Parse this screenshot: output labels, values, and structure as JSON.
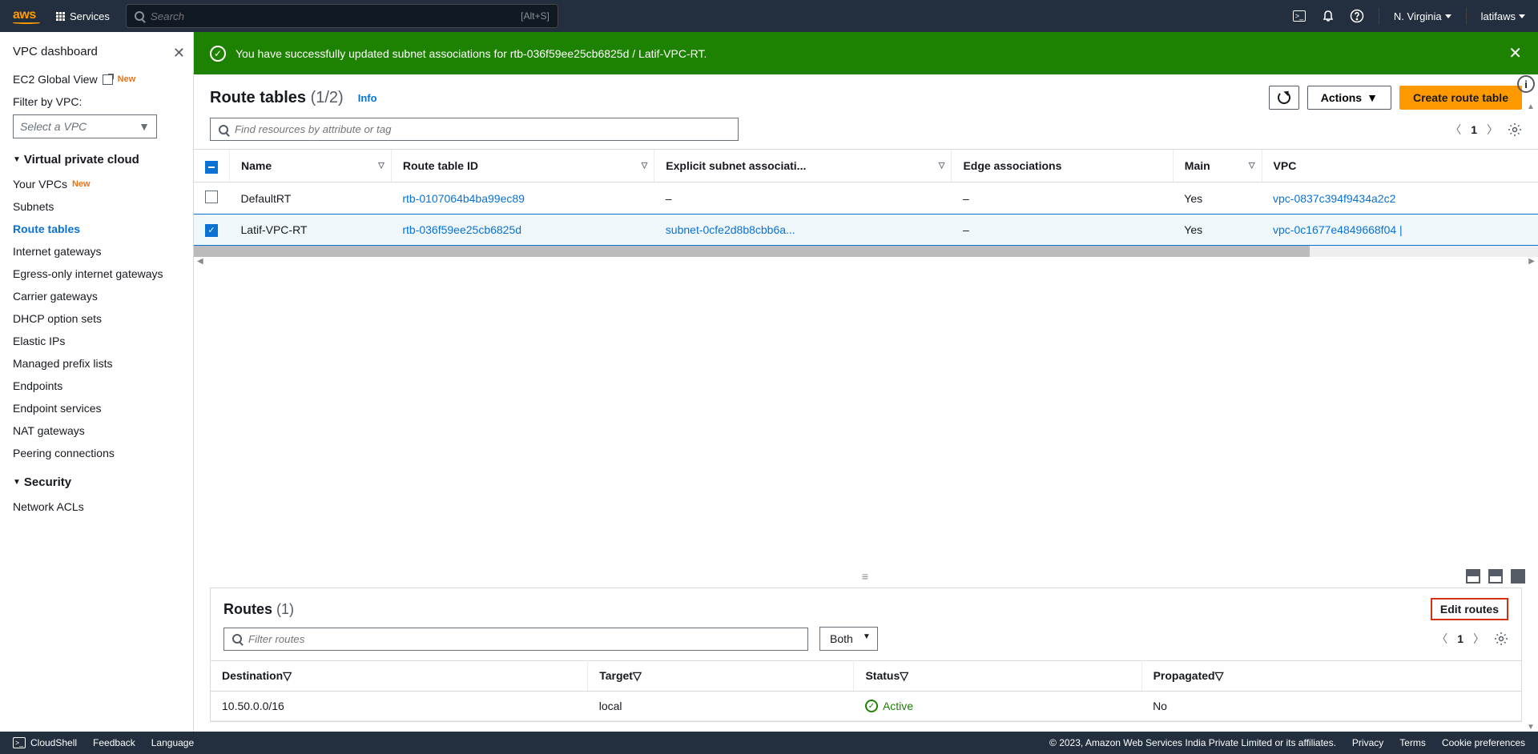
{
  "topnav": {
    "logo": "aws",
    "services": "Services",
    "search_placeholder": "Search",
    "search_kbd": "[Alt+S]",
    "region": "N. Virginia",
    "user": "latifaws"
  },
  "sidebar": {
    "dashboard": "VPC dashboard",
    "ec2_global": "EC2 Global View",
    "new_badge": "New",
    "filter_label": "Filter by VPC:",
    "select_vpc": "Select a VPC",
    "vpc_section": "Virtual private cloud",
    "items": {
      "your_vpcs": "Your VPCs",
      "subnets": "Subnets",
      "route_tables": "Route tables",
      "igw": "Internet gateways",
      "eigw": "Egress-only internet gateways",
      "cgw": "Carrier gateways",
      "dhcp": "DHCP option sets",
      "eip": "Elastic IPs",
      "mpl": "Managed prefix lists",
      "endpoints": "Endpoints",
      "endpoint_services": "Endpoint services",
      "nat": "NAT gateways",
      "peering": "Peering connections"
    },
    "security_section": "Security",
    "nacl": "Network ACLs"
  },
  "banner": {
    "message": "You have successfully updated subnet associations for rtb-036f59ee25cb6825d / Latif-VPC-RT."
  },
  "header": {
    "title": "Route tables",
    "count": "(1/2)",
    "info": "Info",
    "actions": "Actions",
    "create": "Create route table"
  },
  "filter": {
    "placeholder": "Find resources by attribute or tag",
    "page": "1"
  },
  "columns": {
    "name": "Name",
    "rtid": "Route table ID",
    "subnet_assoc": "Explicit subnet associati...",
    "edge_assoc": "Edge associations",
    "main": "Main",
    "vpc": "VPC"
  },
  "rows": [
    {
      "selected": false,
      "name": "DefaultRT",
      "rtid": "rtb-0107064b4ba99ec89",
      "subnet": "–",
      "edge": "–",
      "main": "Yes",
      "vpc": "vpc-0837c394f9434a2c2"
    },
    {
      "selected": true,
      "name": "Latif-VPC-RT",
      "rtid": "rtb-036f59ee25cb6825d",
      "subnet": "subnet-0cfe2d8b8cbb6a...",
      "edge": "–",
      "main": "Yes",
      "vpc": "vpc-0c1677e4849668f04 |"
    }
  ],
  "detail": {
    "title": "Routes",
    "count": "(1)",
    "edit": "Edit routes",
    "filter_placeholder": "Filter routes",
    "scope": "Both",
    "page": "1",
    "cols": {
      "dest": "Destination",
      "target": "Target",
      "status": "Status",
      "prop": "Propagated"
    },
    "rows": [
      {
        "dest": "10.50.0.0/16",
        "target": "local",
        "status": "Active",
        "prop": "No"
      }
    ]
  },
  "footer": {
    "cloudshell": "CloudShell",
    "feedback": "Feedback",
    "language": "Language",
    "copyright": "© 2023, Amazon Web Services India Private Limited or its affiliates.",
    "privacy": "Privacy",
    "terms": "Terms",
    "cookies": "Cookie preferences"
  }
}
